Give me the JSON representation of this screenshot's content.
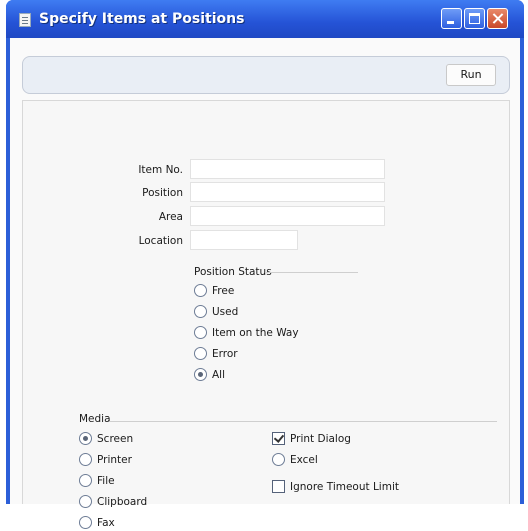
{
  "window": {
    "title": "Specify Items at Positions"
  },
  "toolbar": {
    "run_label": "Run"
  },
  "form": {
    "item_no": {
      "label": "Item No.",
      "value": ""
    },
    "position": {
      "label": "Position",
      "value": ""
    },
    "area": {
      "label": "Area",
      "value": ""
    },
    "location": {
      "label": "Location",
      "value": ""
    }
  },
  "position_status": {
    "title": "Position Status",
    "options": [
      "Free",
      "Used",
      "Item on the Way",
      "Error",
      "All"
    ],
    "selected": "All"
  },
  "media": {
    "title": "Media",
    "options": [
      "Screen",
      "Printer",
      "File",
      "Clipboard",
      "Fax"
    ],
    "selected": "Screen"
  },
  "output_options": {
    "print_dialog": {
      "label": "Print Dialog",
      "checked": true
    },
    "excel": {
      "label": "Excel",
      "selected": false
    },
    "ignore_timeout": {
      "label": "Ignore Timeout Limit",
      "checked": false
    }
  }
}
